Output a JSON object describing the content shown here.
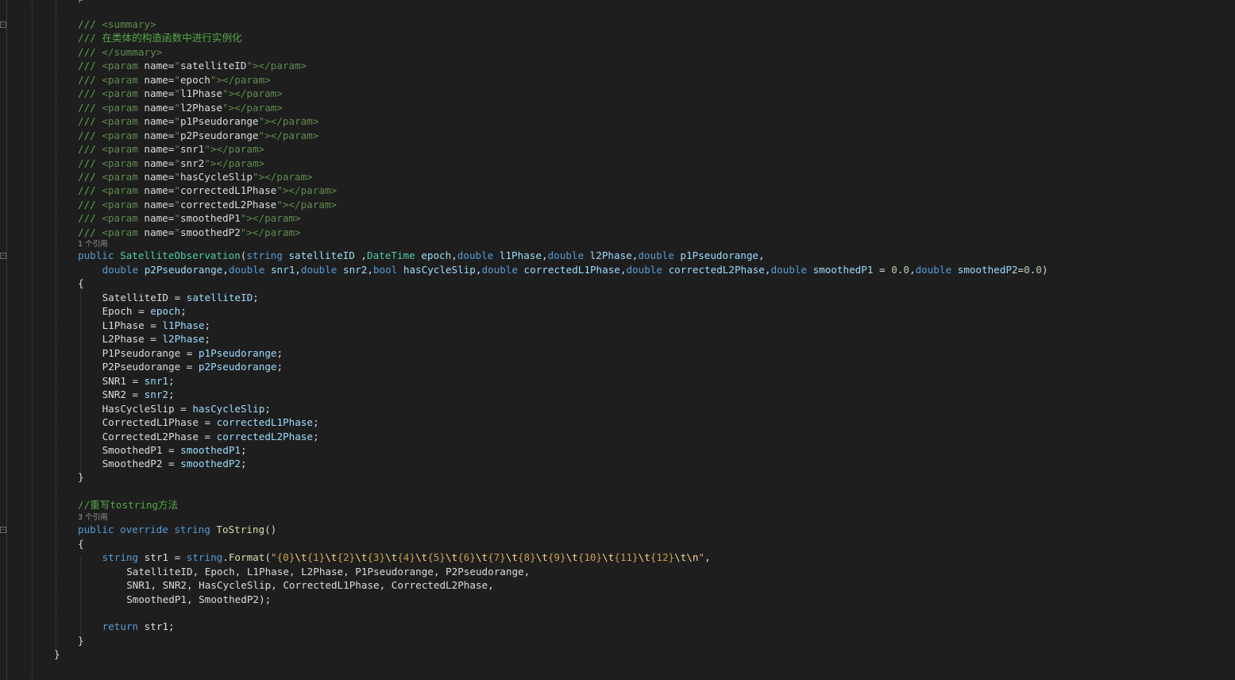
{
  "editor": {
    "doc_comment": {
      "summary_open": "<summary>",
      "summary_text": "在类体的构造函数中进行实例化",
      "summary_close": "</summary>",
      "params": [
        "satelliteID",
        "epoch",
        "l1Phase",
        "l2Phase",
        "p1Pseudorange",
        "p2Pseudorange",
        "snr1",
        "snr2",
        "hasCycleSlip",
        "correctedL1Phase",
        "correctedL2Phase",
        "smoothedP1",
        "smoothedP2"
      ]
    },
    "codelens": {
      "constructor_refs": "1 个引用",
      "tostring_refs": "3 个引用"
    },
    "constructor": {
      "name": "SatelliteObservation",
      "signature_line1": "(string satelliteID ,DateTime epoch,double l1Phase,double l2Phase,double p1Pseudorange,",
      "signature_line2": "double p2Pseudorange,double snr1,double snr2,bool hasCycleSlip,double correctedL1Phase,double correctedL2Phase,double smoothedP1 = 0.0,double smoothedP2=0.0)",
      "assignments": [
        {
          "prop": "SatelliteID",
          "param": "satelliteID"
        },
        {
          "prop": "Epoch",
          "param": "epoch"
        },
        {
          "prop": "L1Phase",
          "param": "l1Phase"
        },
        {
          "prop": "L2Phase",
          "param": "l2Phase"
        },
        {
          "prop": "P1Pseudorange",
          "param": "p1Pseudorange"
        },
        {
          "prop": "P2Pseudorange",
          "param": "p2Pseudorange"
        },
        {
          "prop": "SNR1",
          "param": "snr1"
        },
        {
          "prop": "SNR2",
          "param": "snr2"
        },
        {
          "prop": "HasCycleSlip",
          "param": "hasCycleSlip"
        },
        {
          "prop": "CorrectedL1Phase",
          "param": "correctedL1Phase"
        },
        {
          "prop": "CorrectedL2Phase",
          "param": "correctedL2Phase"
        },
        {
          "prop": "SmoothedP1",
          "param": "smoothedP1"
        },
        {
          "prop": "SmoothedP2",
          "param": "smoothedP2"
        }
      ]
    },
    "tostring": {
      "comment": "//重写tostring方法",
      "signature": "public override string ToString()",
      "format_string": "\"{0}\\t{1}\\t{2}\\t{3}\\t{4}\\t{5}\\t{6}\\t{7}\\t{8}\\t{9}\\t{10}\\t{11}\\t{12}\\t\\n\"",
      "args_line1": "SatelliteID, Epoch, L1Phase, L2Phase, P1Pseudorange, P2Pseudorange,",
      "args_line2": "SNR1, SNR2, HasCycleSlip, CorrectedL1Phase, CorrectedL2Phase,",
      "args_line3": "SmoothedP1, SmoothedP2);",
      "return_line": "return str1;"
    }
  }
}
